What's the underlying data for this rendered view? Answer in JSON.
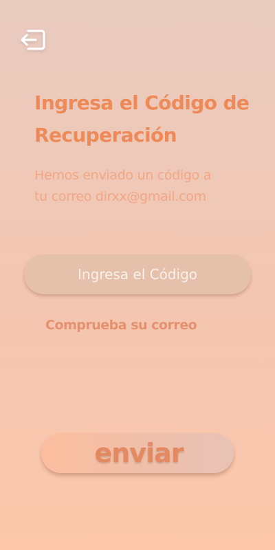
{
  "header": {
    "back_icon": "logout-arrow-icon"
  },
  "content": {
    "title": "Ingresa el Código de Recuperación",
    "subtitle_line1": "Hemos enviado un código a",
    "subtitle_line2": "tu correo dirxx@gmail.com",
    "code_placeholder": "Ingresa el Código",
    "code_value": "",
    "check_email_label": "Comprueba su correo"
  },
  "actions": {
    "send_label": "enviar"
  },
  "colors": {
    "accent": "#ee8a58",
    "subtitle": "#f2a684",
    "input_bg": "#e5c0ab",
    "background_top": "#e9cbc0",
    "background_bottom": "#fcc7aa"
  }
}
